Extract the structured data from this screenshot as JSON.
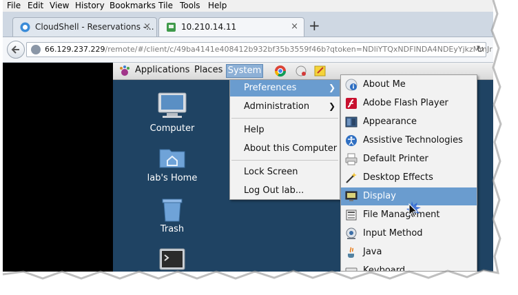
{
  "menubar": {
    "items": [
      "File",
      "Edit",
      "View",
      "History",
      "Bookmarks",
      "Tile",
      "Tools",
      "Help"
    ]
  },
  "tabs": [
    {
      "label": "CloudShell - Reservations -...",
      "icon": "cloudshell-icon",
      "close": "×"
    },
    {
      "label": "10.210.14.11",
      "icon": "remote-desktop-icon",
      "close": "×"
    }
  ],
  "new_tab_label": "+",
  "navbar": {
    "url_host": "66.129.237.229",
    "url_rest": "/remote/#/client/c/49ba4141e408412b932bf35b3559f46b?qtoken=NDliYTQxNDFINDA4NDEyYjkzMmJr",
    "reload_glyph": "↻"
  },
  "panel": {
    "applications": "Applications",
    "places": "Places",
    "system": "System"
  },
  "desktop_icons": [
    {
      "label": "Computer",
      "icon": "computer-icon"
    },
    {
      "label": "lab's Home",
      "icon": "home-folder-icon"
    },
    {
      "label": "Trash",
      "icon": "trash-icon"
    },
    {
      "label": "",
      "icon": "terminal-icon"
    }
  ],
  "system_menu": {
    "items": [
      {
        "label": "Preferences",
        "has_submenu": true,
        "highlighted": true
      },
      {
        "label": "Administration",
        "has_submenu": true
      },
      {
        "label": "Help"
      },
      {
        "label": "About this Computer"
      },
      {
        "label": "Lock Screen"
      },
      {
        "label": "Log Out lab..."
      }
    ],
    "submenu_arrow": "❯"
  },
  "preferences_menu": {
    "items": [
      {
        "label": "About Me",
        "icon": "about-me-icon"
      },
      {
        "label": "Adobe Flash Player",
        "icon": "flash-player-icon"
      },
      {
        "label": "Appearance",
        "icon": "appearance-icon"
      },
      {
        "label": "Assistive Technologies",
        "icon": "accessibility-icon"
      },
      {
        "label": "Default Printer",
        "icon": "printer-icon"
      },
      {
        "label": "Desktop Effects",
        "icon": "desktop-effects-icon"
      },
      {
        "label": "Display",
        "icon": "display-icon",
        "highlighted": true
      },
      {
        "label": "File Management",
        "icon": "file-management-icon"
      },
      {
        "label": "Input Method",
        "icon": "input-method-icon"
      },
      {
        "label": "Java",
        "icon": "java-icon"
      },
      {
        "label": "Keyboard",
        "icon": "keyboard-icon"
      }
    ]
  },
  "colors": {
    "desktop_bg": "#1f4363",
    "highlight": "#6a9ccf",
    "menu_bg": "#f2f2f2"
  }
}
